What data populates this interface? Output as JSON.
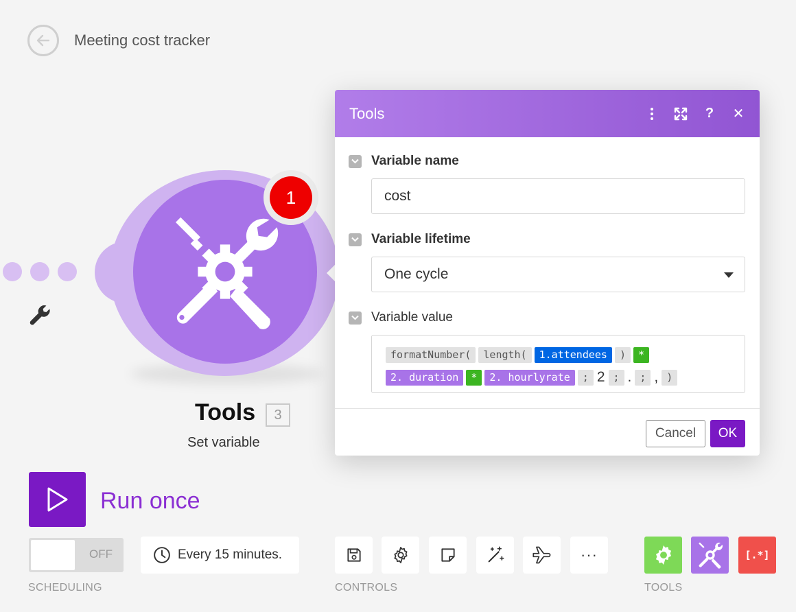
{
  "header": {
    "scenario_name": "Meeting cost tracker"
  },
  "module": {
    "title": "Tools",
    "count": "3",
    "subtitle": "Set variable",
    "badge": "1",
    "color": "#a873e8"
  },
  "run": {
    "label": "Run once"
  },
  "scheduling": {
    "toggle_state": "OFF",
    "interval": "Every 15 minutes.",
    "section_label": "SCHEDULING"
  },
  "controls": {
    "section_label": "CONTROLS",
    "items": [
      "save-icon",
      "gear-icon",
      "note-icon",
      "magic-wand-icon",
      "airplane-icon",
      "more-icon"
    ],
    "more_glyph": "···"
  },
  "tools": {
    "section_label": "TOOLS",
    "items": [
      {
        "name": "flow-control-gear-icon",
        "color": "#7ed957"
      },
      {
        "name": "tools-icon",
        "color": "#a873e8"
      },
      {
        "name": "text-parser-brackets-icon",
        "color": "#f0504b",
        "glyph": "[.*]"
      }
    ]
  },
  "dialog": {
    "title": "Tools",
    "header_icons": [
      "more-vertical-icon",
      "expand-icon",
      "help-icon",
      "close-icon"
    ],
    "help_glyph": "?",
    "close_glyph": "✕",
    "fields": {
      "name": {
        "label": "Variable name",
        "value": "cost"
      },
      "lifetime": {
        "label": "Variable lifetime",
        "value": "One cycle"
      },
      "value": {
        "label": "Variable value",
        "row1": {
          "fn1": "formatNumber(",
          "fn2": "length(",
          "var1": "1.attendees",
          "close1": ")",
          "op1": "*"
        },
        "row2": {
          "mod1": "2. duration",
          "op2": "*",
          "mod2": "2. hourlyrate",
          "sep1": ";",
          "lit1": "2",
          "sep2": ";",
          "lit2": ".",
          "sep3": ";",
          "lit3": ",",
          "close2": ")"
        }
      }
    },
    "cancel_label": "Cancel",
    "ok_label": "OK"
  }
}
